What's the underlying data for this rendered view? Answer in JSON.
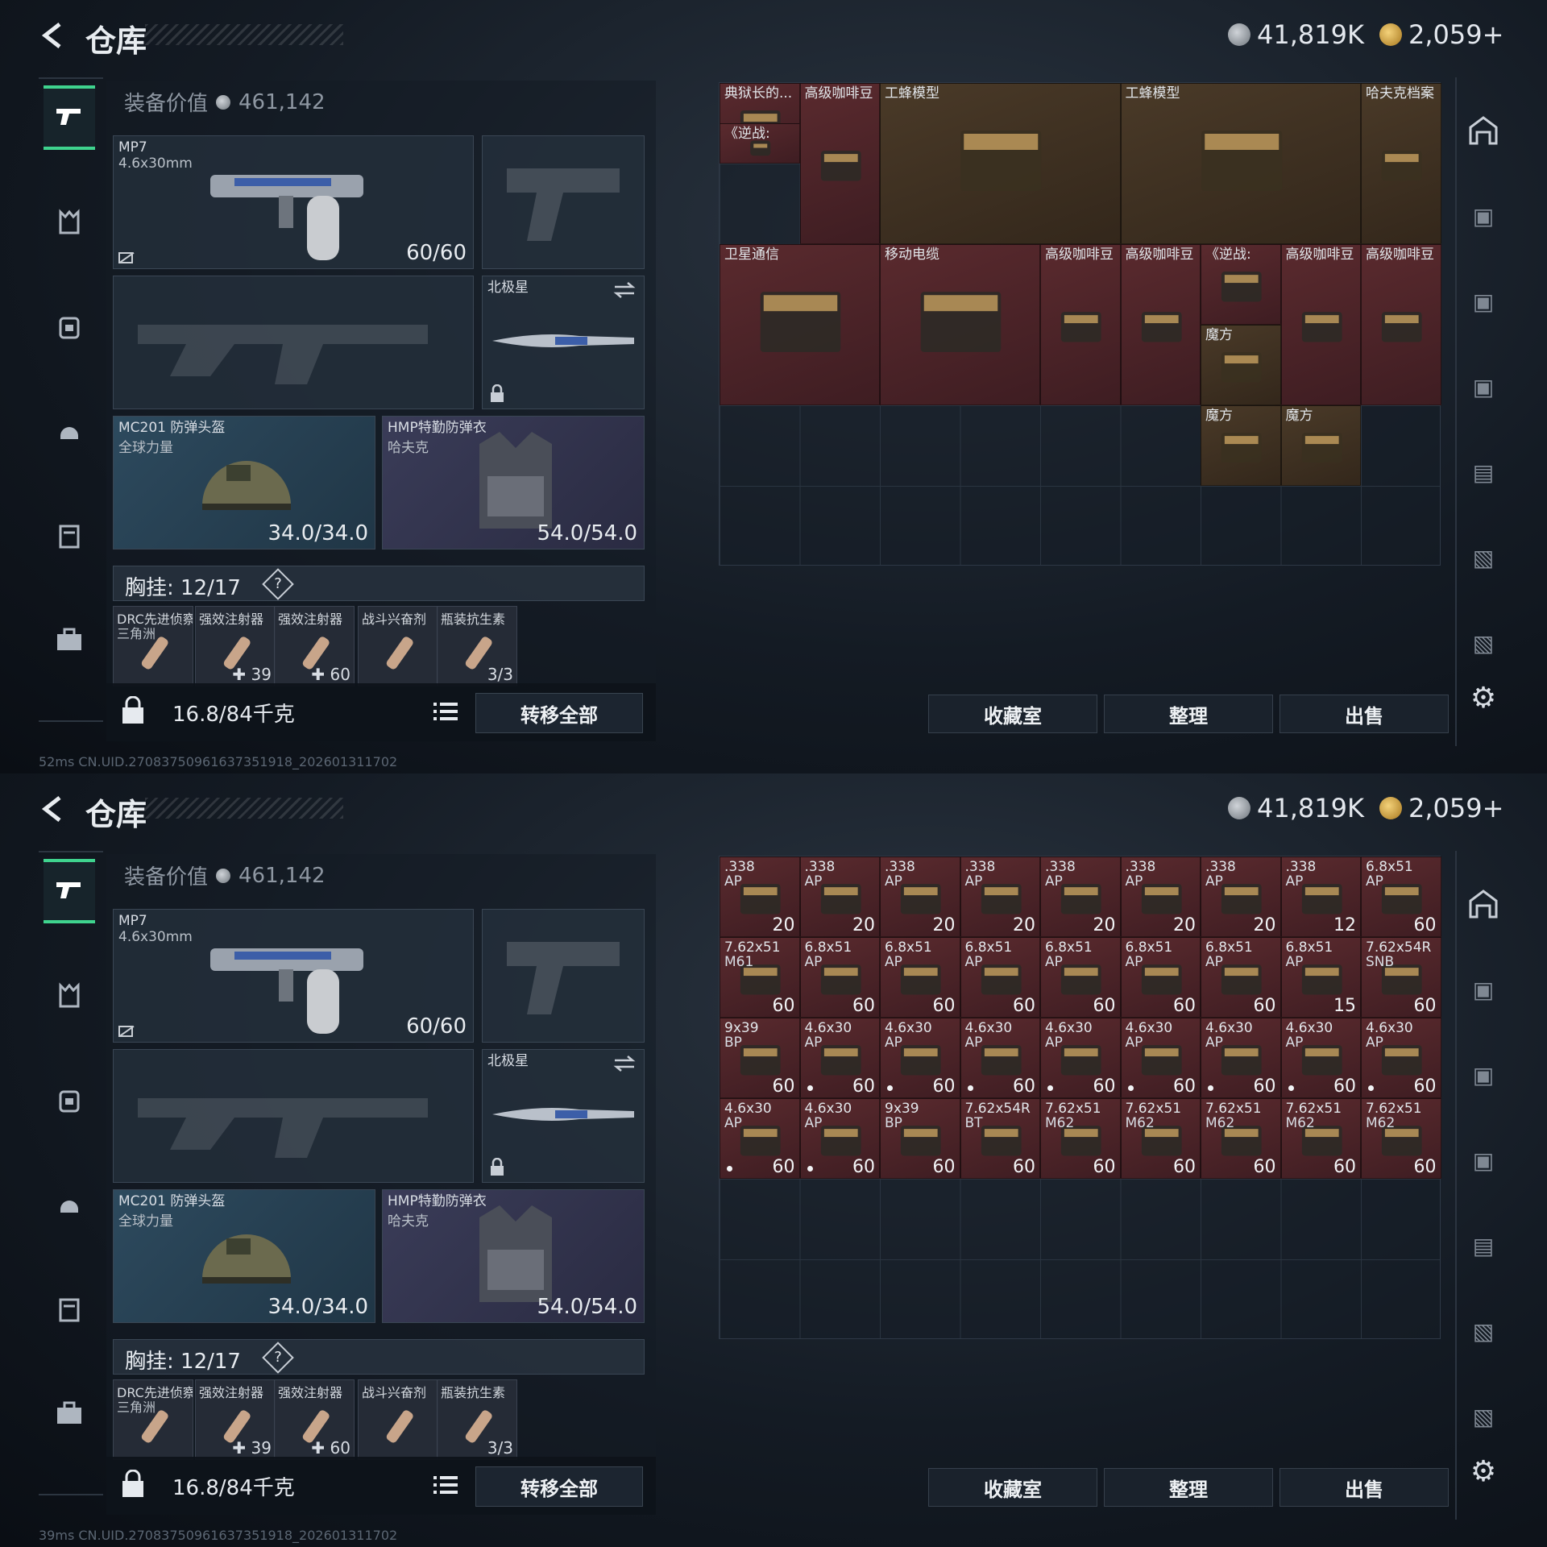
{
  "screens": [
    {
      "header": {
        "title": "仓库",
        "silver": "41,819K",
        "gold": "2,059+"
      },
      "equip_value_label": "装备价值",
      "equip_value": "461,142",
      "weapon1": {
        "name": "MP7",
        "caliber": "4.6x30mm",
        "ammo": "60/60"
      },
      "weapon3": {
        "name": "北极星"
      },
      "helmet": {
        "name": "MC201 防弹头盔",
        "sub": "全球力量",
        "durability": "34.0/34.0"
      },
      "armor": {
        "name": "HMP特勤防弹衣",
        "sub": "哈夫克",
        "durability": "54.0/54.0"
      },
      "chest": {
        "label": "胸挂: 12/17",
        "help": "?"
      },
      "pockets": [
        {
          "name": "DRC先进侦察...",
          "sub": "三角洲",
          "count": ""
        },
        {
          "name": "强效注射器",
          "sub": "",
          "count": "✚ 39"
        },
        {
          "name": "强效注射器",
          "sub": "",
          "count": "✚ 60"
        },
        {
          "name": "战斗兴奋剂",
          "sub": "",
          "count": ""
        },
        {
          "name": "瓶装抗生素",
          "sub": "",
          "count": "3/3"
        }
      ],
      "weight": "16.8/84千克",
      "transfer_all": "转移全部",
      "buttons": {
        "collection": "收藏室",
        "organize": "整理",
        "sell": "出售"
      },
      "status": "52ms     CN.UID.270837509616373519​18_202601311702",
      "stash_items": [
        {
          "name": "典狱长的...",
          "sub": "",
          "count": "",
          "color": "red",
          "r": 0,
          "c": 0,
          "w": 1,
          "h": 1
        },
        {
          "name": "《逆战:",
          "sub": "",
          "count": "",
          "color": "red",
          "r": 0.5,
          "c": 0,
          "w": 1,
          "h": 0.5
        },
        {
          "name": "高级咖啡豆",
          "sub": "",
          "count": "",
          "color": "red",
          "r": 0,
          "c": 1,
          "w": 1,
          "h": 2
        },
        {
          "name": "工蜂模型",
          "sub": "",
          "count": "",
          "color": "gold",
          "r": 0,
          "c": 2,
          "w": 3,
          "h": 2
        },
        {
          "name": "工蜂模型",
          "sub": "",
          "count": "",
          "color": "gold",
          "r": 0,
          "c": 5,
          "w": 3,
          "h": 2
        },
        {
          "name": "哈夫克档案",
          "sub": "",
          "count": "",
          "color": "gold",
          "r": 0,
          "c": 8,
          "w": 1,
          "h": 2
        },
        {
          "name": "卫星通信",
          "sub": "",
          "count": "",
          "color": "red",
          "r": 2,
          "c": 0,
          "w": 2,
          "h": 2
        },
        {
          "name": "移动电缆",
          "sub": "",
          "count": "",
          "color": "red",
          "r": 2,
          "c": 2,
          "w": 2,
          "h": 2
        },
        {
          "name": "高级咖啡豆",
          "sub": "",
          "count": "",
          "color": "red",
          "r": 2,
          "c": 4,
          "w": 1,
          "h": 2
        },
        {
          "name": "高级咖啡豆",
          "sub": "",
          "count": "",
          "color": "red",
          "r": 2,
          "c": 5,
          "w": 1,
          "h": 2
        },
        {
          "name": "《逆战:",
          "sub": "",
          "count": "",
          "color": "red",
          "r": 2,
          "c": 6,
          "w": 1,
          "h": 1
        },
        {
          "name": "魔方",
          "sub": "",
          "count": "",
          "color": "gold",
          "r": 3,
          "c": 6,
          "w": 1,
          "h": 1
        },
        {
          "name": "高级咖啡豆",
          "sub": "",
          "count": "",
          "color": "red",
          "r": 2,
          "c": 7,
          "w": 1,
          "h": 2
        },
        {
          "name": "高级咖啡豆",
          "sub": "",
          "count": "",
          "color": "red",
          "r": 2,
          "c": 8,
          "w": 1,
          "h": 2
        },
        {
          "name": "魔方",
          "sub": "",
          "count": "",
          "color": "gold",
          "r": 4,
          "c": 6,
          "w": 1,
          "h": 1
        },
        {
          "name": "魔方",
          "sub": "",
          "count": "",
          "color": "gold",
          "r": 4,
          "c": 7,
          "w": 1,
          "h": 1
        }
      ]
    },
    {
      "header": {
        "title": "仓库",
        "silver": "41,819K",
        "gold": "2,059+"
      },
      "equip_value_label": "装备价值",
      "equip_value": "461,142",
      "weapon1": {
        "name": "MP7",
        "caliber": "4.6x30mm",
        "ammo": "60/60"
      },
      "weapon3": {
        "name": "北极星"
      },
      "helmet": {
        "name": "MC201 防弹头盔",
        "sub": "全球力量",
        "durability": "34.0/34.0"
      },
      "armor": {
        "name": "HMP特勤防弹衣",
        "sub": "哈夫克",
        "durability": "54.0/54.0"
      },
      "chest": {
        "label": "胸挂: 12/17",
        "help": "?"
      },
      "pockets": [
        {
          "name": "DRC先进侦察...",
          "sub": "三角洲",
          "count": ""
        },
        {
          "name": "强效注射器",
          "sub": "",
          "count": "✚ 39"
        },
        {
          "name": "强效注射器",
          "sub": "",
          "count": "✚ 60"
        },
        {
          "name": "战斗兴奋剂",
          "sub": "",
          "count": ""
        },
        {
          "name": "瓶装抗生素",
          "sub": "",
          "count": "3/3"
        }
      ],
      "weight": "16.8/84千克",
      "transfer_all": "转移全部",
      "buttons": {
        "collection": "收藏室",
        "organize": "整理",
        "sell": "出售"
      },
      "status": "39ms     CN.UID.270837509616373519​18_202601311702",
      "stash_items": [
        {
          "name": ".338",
          "sub": "AP",
          "count": "20",
          "color": "red",
          "r": 0,
          "c": 0,
          "w": 1,
          "h": 1
        },
        {
          "name": ".338",
          "sub": "AP",
          "count": "20",
          "color": "red",
          "r": 0,
          "c": 1,
          "w": 1,
          "h": 1
        },
        {
          "name": ".338",
          "sub": "AP",
          "count": "20",
          "color": "red",
          "r": 0,
          "c": 2,
          "w": 1,
          "h": 1
        },
        {
          "name": ".338",
          "sub": "AP",
          "count": "20",
          "color": "red",
          "r": 0,
          "c": 3,
          "w": 1,
          "h": 1
        },
        {
          "name": ".338",
          "sub": "AP",
          "count": "20",
          "color": "red",
          "r": 0,
          "c": 4,
          "w": 1,
          "h": 1
        },
        {
          "name": ".338",
          "sub": "AP",
          "count": "20",
          "color": "red",
          "r": 0,
          "c": 5,
          "w": 1,
          "h": 1
        },
        {
          "name": ".338",
          "sub": "AP",
          "count": "20",
          "color": "red",
          "r": 0,
          "c": 6,
          "w": 1,
          "h": 1
        },
        {
          "name": ".338",
          "sub": "AP",
          "count": "12",
          "color": "red",
          "r": 0,
          "c": 7,
          "w": 1,
          "h": 1
        },
        {
          "name": "6.8x51",
          "sub": "AP",
          "count": "60",
          "color": "red",
          "r": 0,
          "c": 8,
          "w": 1,
          "h": 1
        },
        {
          "name": "7.62x51",
          "sub": "M61",
          "count": "60",
          "color": "red",
          "r": 1,
          "c": 0,
          "w": 1,
          "h": 1
        },
        {
          "name": "6.8x51",
          "sub": "AP",
          "count": "60",
          "color": "red",
          "r": 1,
          "c": 1,
          "w": 1,
          "h": 1
        },
        {
          "name": "6.8x51",
          "sub": "AP",
          "count": "60",
          "color": "red",
          "r": 1,
          "c": 2,
          "w": 1,
          "h": 1
        },
        {
          "name": "6.8x51",
          "sub": "AP",
          "count": "60",
          "color": "red",
          "r": 1,
          "c": 3,
          "w": 1,
          "h": 1
        },
        {
          "name": "6.8x51",
          "sub": "AP",
          "count": "60",
          "color": "red",
          "r": 1,
          "c": 4,
          "w": 1,
          "h": 1
        },
        {
          "name": "6.8x51",
          "sub": "AP",
          "count": "60",
          "color": "red",
          "r": 1,
          "c": 5,
          "w": 1,
          "h": 1
        },
        {
          "name": "6.8x51",
          "sub": "AP",
          "count": "60",
          "color": "red",
          "r": 1,
          "c": 6,
          "w": 1,
          "h": 1
        },
        {
          "name": "6.8x51",
          "sub": "AP",
          "count": "15",
          "color": "red",
          "r": 1,
          "c": 7,
          "w": 1,
          "h": 1
        },
        {
          "name": "7.62x54R",
          "sub": "SNB",
          "count": "60",
          "color": "red",
          "r": 1,
          "c": 8,
          "w": 1,
          "h": 1
        },
        {
          "name": "9x39",
          "sub": "BP",
          "count": "60",
          "color": "red",
          "r": 2,
          "c": 0,
          "w": 1,
          "h": 1
        },
        {
          "name": "4.6x30",
          "sub": "AP",
          "count": "60",
          "color": "red",
          "r": 2,
          "c": 1,
          "w": 1,
          "h": 1,
          "dot": true
        },
        {
          "name": "4.6x30",
          "sub": "AP",
          "count": "60",
          "color": "red",
          "r": 2,
          "c": 2,
          "w": 1,
          "h": 1,
          "dot": true
        },
        {
          "name": "4.6x30",
          "sub": "AP",
          "count": "60",
          "color": "red",
          "r": 2,
          "c": 3,
          "w": 1,
          "h": 1,
          "dot": true
        },
        {
          "name": "4.6x30",
          "sub": "AP",
          "count": "60",
          "color": "red",
          "r": 2,
          "c": 4,
          "w": 1,
          "h": 1,
          "dot": true
        },
        {
          "name": "4.6x30",
          "sub": "AP",
          "count": "60",
          "color": "red",
          "r": 2,
          "c": 5,
          "w": 1,
          "h": 1,
          "dot": true
        },
        {
          "name": "4.6x30",
          "sub": "AP",
          "count": "60",
          "color": "red",
          "r": 2,
          "c": 6,
          "w": 1,
          "h": 1,
          "dot": true
        },
        {
          "name": "4.6x30",
          "sub": "AP",
          "count": "60",
          "color": "red",
          "r": 2,
          "c": 7,
          "w": 1,
          "h": 1,
          "dot": true
        },
        {
          "name": "4.6x30",
          "sub": "AP",
          "count": "60",
          "color": "red",
          "r": 2,
          "c": 8,
          "w": 1,
          "h": 1,
          "dot": true
        },
        {
          "name": "4.6x30",
          "sub": "AP",
          "count": "60",
          "color": "red",
          "r": 3,
          "c": 0,
          "w": 1,
          "h": 1,
          "dot": true
        },
        {
          "name": "4.6x30",
          "sub": "AP",
          "count": "60",
          "color": "red",
          "r": 3,
          "c": 1,
          "w": 1,
          "h": 1,
          "dot": true
        },
        {
          "name": "9x39",
          "sub": "BP",
          "count": "60",
          "color": "red",
          "r": 3,
          "c": 2,
          "w": 1,
          "h": 1
        },
        {
          "name": "7.62x54R",
          "sub": "BT",
          "count": "60",
          "color": "red",
          "r": 3,
          "c": 3,
          "w": 1,
          "h": 1
        },
        {
          "name": "7.62x51",
          "sub": "M62",
          "count": "60",
          "color": "red",
          "r": 3,
          "c": 4,
          "w": 1,
          "h": 1
        },
        {
          "name": "7.62x51",
          "sub": "M62",
          "count": "60",
          "color": "red",
          "r": 3,
          "c": 5,
          "w": 1,
          "h": 1
        },
        {
          "name": "7.62x51",
          "sub": "M62",
          "count": "60",
          "color": "red",
          "r": 3,
          "c": 6,
          "w": 1,
          "h": 1
        },
        {
          "name": "7.62x51",
          "sub": "M62",
          "count": "60",
          "color": "red",
          "r": 3,
          "c": 7,
          "w": 1,
          "h": 1
        },
        {
          "name": "7.62x51",
          "sub": "M62",
          "count": "60",
          "color": "red",
          "r": 3,
          "c": 8,
          "w": 1,
          "h": 1
        }
      ]
    }
  ],
  "colors": {
    "accent": "#3fd38e",
    "item_red": "#5a2a2e",
    "item_gold": "#4a3a28"
  }
}
